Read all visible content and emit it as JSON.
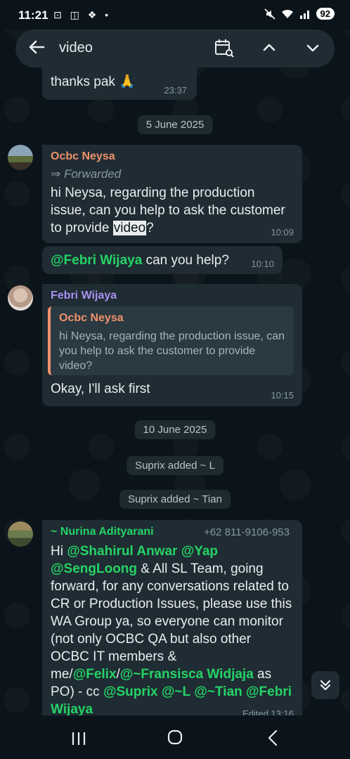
{
  "status_bar": {
    "time": "11:21",
    "left_icons": "⊡ ◫ ❖ •",
    "battery": "92"
  },
  "search": {
    "query": "video"
  },
  "messages": {
    "m0": {
      "text": "thanks pak 🙏",
      "time": "23:37"
    },
    "date1": "5 June 2025",
    "m1": {
      "sender": "Ocbc Neysa",
      "forwarded": "Forwarded",
      "text_before": "hi Neysa, regarding the production issue, can you help to ask the customer to provide ",
      "highlight": "video",
      "text_after": "?",
      "time": "10:09"
    },
    "m2": {
      "mention": "@Febri Wijaya",
      "text": " can you help?",
      "time": "10:10"
    },
    "m3": {
      "sender": "Febri Wijaya",
      "quote_sender": "Ocbc Neysa",
      "quote_text": "hi Neysa, regarding the production issue, can you help to ask the customer to provide video?",
      "text": "Okay, I'll ask first",
      "time": "10:15"
    },
    "date2": "10 June 2025",
    "sys1": "Suprix added ~ L",
    "sys2": "Suprix added ~ Tian",
    "m4": {
      "sender": "~ Nurina Adityarani",
      "phone": "+62 811-9106-953",
      "p1": "Hi ",
      "mention1": "@Shahirul Anwar",
      "p2": " ",
      "mention2": "@Yap @SengLoong",
      "p3": " & All SL Team, going forward, for any conversations related to CR or Production Issues, please use this WA Group ya, so everyone can monitor (not only OCBC QA but also other OCBC IT members & me/",
      "mention3": "@Felix",
      "p4": "/",
      "mention4": "@~Fransisca Widjaja",
      "p5": " as PO) - cc ",
      "mention5": "@Suprix",
      "p6": " ",
      "mention6": "@~L",
      "p7": " ",
      "mention7": "@~Tian",
      "p8": " ",
      "mention8": "@Febri Wijaya",
      "time": "Edited 13:16"
    }
  },
  "colors": {
    "ocbc_sender": "#f0926a",
    "febri_sender": "#a791f0",
    "nurina_sender": "#25d366",
    "quote_bar": "#f0926a",
    "mention": "#25d366"
  }
}
